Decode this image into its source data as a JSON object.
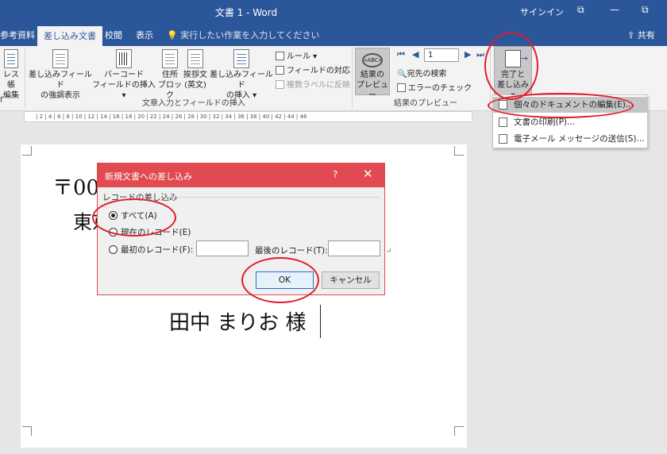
{
  "titlebar": {
    "title": "文書 1  -  Word",
    "signin": "サインイン",
    "restore_glyph": "⧉",
    "min_glyph": "—",
    "max_glyph": "⧉"
  },
  "tabs": {
    "references": "参考資料",
    "mailings": "差し込み文書",
    "review": "校閲",
    "view": "表示",
    "tellme": "実行したい作業を入力してください",
    "share": "共有"
  },
  "ribbon": {
    "address_book_1": "レス帳",
    "address_book_2": "編集",
    "group_edge": "f",
    "highlight_1": "差し込みフィールド",
    "highlight_2": "の強調表示",
    "barcode_1": "バーコード",
    "barcode_2": "フィールドの挿入 ▾",
    "address_1": "住所",
    "address_2": "ブロック",
    "greeting_1": "挨拶文",
    "greeting_2": "(英文)",
    "insert_field_1": "差し込みフィールド",
    "insert_field_2": "の挿入 ▾",
    "rules": "ルール ▾",
    "match_fields": "フィールドの対応",
    "update_labels": "複数ラベルに反映",
    "group_write": "文章入力とフィールドの挿入",
    "preview_1": "結果の",
    "preview_2": "プレビュー",
    "record_value": "1",
    "find_recipient": "宛先の検索",
    "check_errors": "エラーのチェック",
    "group_preview": "結果のプレビュー",
    "finish_1": "完了と",
    "finish_2": "差し込み ▾",
    "abc_text": "«ABC»"
  },
  "ruler": {
    "ticks": "|  2  |  4  |  6  |  8  |  10  |  12  |  14  |  16  |  18  |  20  |  22  |  24  |  26  |  28  |  30  |  32  |  34  |  36  |  38  |  40  |  42  |  44  |  46"
  },
  "dropdown": {
    "edit_docs": "個々のドキュメントの編集(E)...",
    "print_docs": "文書の印刷(P)...",
    "send_email": "電子メール メッセージの送信(S)..."
  },
  "document": {
    "postal": "〒000",
    "address": "東京",
    "recipient": "田中  まりお  様",
    "return_mark": "↵"
  },
  "dialog": {
    "title": "新規文書への差し込み",
    "help": "?",
    "close": "✕",
    "group_label": "レコードの差し込み",
    "all": "すべて(A)",
    "current": "現在のレコード(E)",
    "from": "最初のレコード(F):",
    "to": "最後のレコード(T):",
    "from_value": "",
    "to_value": "",
    "ok": "OK",
    "cancel": "キャンセル"
  },
  "colors": {
    "word_blue": "#2b579a",
    "dialog_red": "#e04a50",
    "annotation_red": "#e01c2a"
  }
}
